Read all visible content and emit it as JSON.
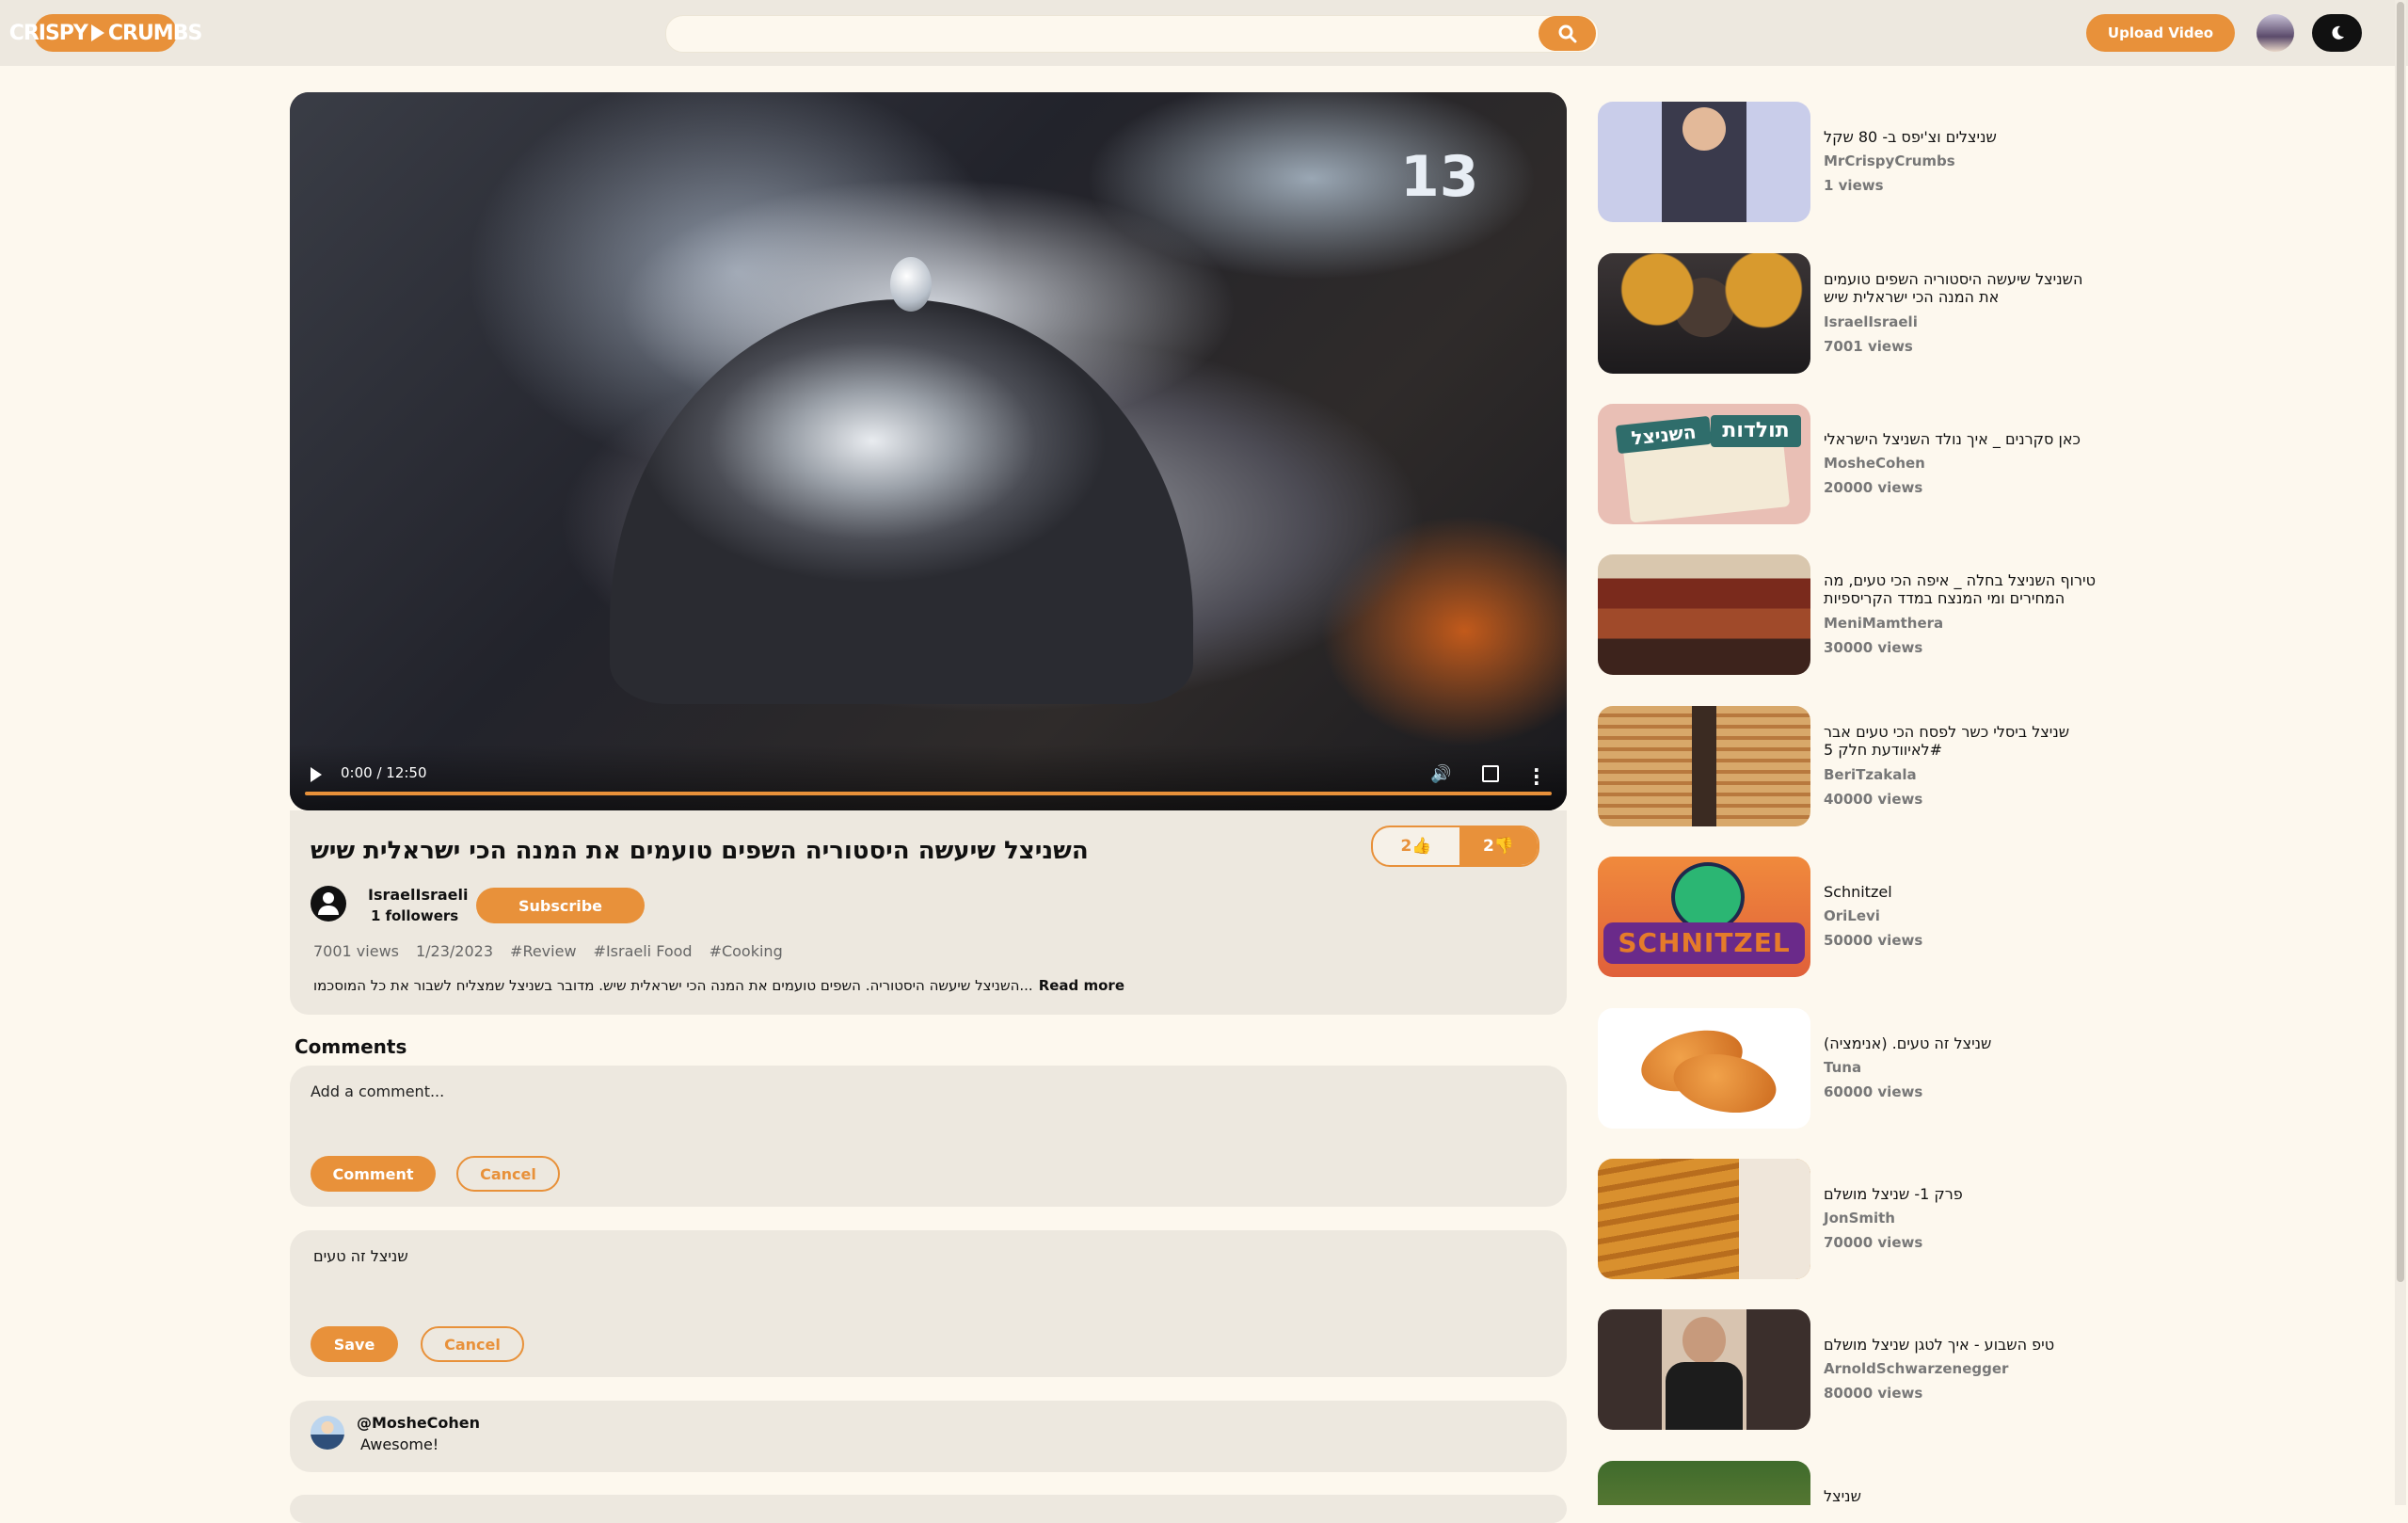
{
  "header": {
    "logo_text": "CRISPY",
    "logo_text2": "CRUMBS",
    "search_placeholder": "",
    "upload_label": "Upload Video"
  },
  "player": {
    "time": "0:00 / 12:50",
    "watermark": "13",
    "progress": 0
  },
  "video": {
    "title": "השניצל שיעשה היסטוריה השפים טועמים את המנה הכי ישראלית שיש",
    "likes": "2",
    "dislikes": "2",
    "channel": "IsraelIsraeli",
    "followers_count": "1",
    "followers_label": "followers",
    "subscribe_label": "Subscribe",
    "views": "7001 views",
    "date": "1/23/2023",
    "tags": [
      "#Review",
      "#Israeli Food",
      "#Cooking"
    ],
    "description": "השניצל שיעשה היסטוריה. השפים טועמים את המנה הכי ישראלית שיש. מדובר בשניצל שמצליח לשבור את כל המוסכמו...",
    "read_more": "Read more"
  },
  "comments": {
    "heading": "Comments",
    "add_placeholder": "Add a comment...",
    "comment_btn": "Comment",
    "cancel_btn": "Cancel",
    "edit_text": "שניצל זה טעים",
    "save_btn": "Save",
    "cancel_btn2": "Cancel",
    "items": [
      {
        "user": "@MosheCohen",
        "text": "Awesome!"
      }
    ]
  },
  "sidebar": {
    "items": [
      {
        "title": "שניצלים וצ'יפס ב- 80 שקל",
        "author": "MrCrispyCrumbs",
        "views": "1 views"
      },
      {
        "title": "השניצל שיעשה היסטוריה השפים טועמים את המנה הכי ישראלית שיש",
        "author": "IsraelIsraeli",
        "views": "7001 views"
      },
      {
        "title": "כאן סקרנים _ איך נולד השניצל הישראלי",
        "author": "MosheCohen",
        "views": "20000 views"
      },
      {
        "title": "טירוף השניצל בחלה _ איפה הכי טעים, מה המחירים ומי המנצח במדד הקריספיות",
        "author": "MeniMamthera",
        "views": "30000 views"
      },
      {
        "title": "שניצל ביסלי כשר לפסח הכי טעים אבר #לאיוודעת חלק 5",
        "author": "BeriTzakala",
        "views": "40000 views"
      },
      {
        "title": "Schnitzel",
        "author": "OriLevi",
        "views": "50000 views"
      },
      {
        "title": "שניצל זה טעים. (אנימציה)",
        "author": "Tuna",
        "views": "60000 views"
      },
      {
        "title": "פרק 1- שניצל מושלם",
        "author": "JonSmith",
        "views": "70000 views"
      },
      {
        "title": "טיפ השבוע - איך לטגן שניצל מושלם",
        "author": "ArnoldSchwarzenegger",
        "views": "80000 views"
      },
      {
        "title": "שניצל",
        "author": "",
        "views": ""
      }
    ]
  },
  "thumb_labels": {
    "t3_a": "תולדות",
    "t3_b": "השניצל",
    "t6": "SCHNITZEL"
  }
}
